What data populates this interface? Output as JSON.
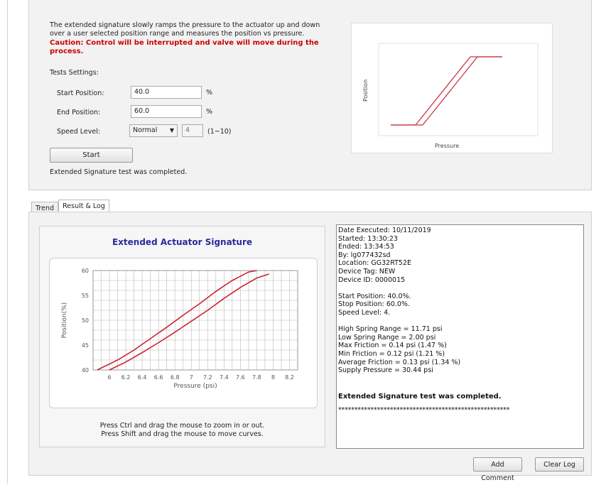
{
  "settings": {
    "description": "The extended signature slowly ramps the pressure to the actuator up and down over a user selected position range and measures the position vs pressure.",
    "caution": "Caution: Control will be interrupted and valve will move during the process.",
    "tests_settings_label": "Tests Settings:",
    "start_position_label": "Start Position:",
    "start_position_value": "40.0",
    "end_position_label": "End Position:",
    "end_position_value": "60.0",
    "unit": "%",
    "speed_level_label": "Speed Level:",
    "speed_select_value": "Normal",
    "speed_number_value": "4",
    "speed_range": "(1~10)",
    "start_button": "Start",
    "status": "Extended Signature test was completed."
  },
  "preview_chart": {
    "ylabel": "Position",
    "xlabel": "Pressure"
  },
  "tabs": [
    {
      "label": "Trend",
      "active": false
    },
    {
      "label": "Result & Log",
      "active": true
    }
  ],
  "chart_data": {
    "type": "line",
    "title": "Extended Actuator Signature",
    "xlabel": "Pressure (psi)",
    "ylabel": "Position(%)",
    "xlim": [
      5.8,
      8.3
    ],
    "ylim": [
      40,
      60
    ],
    "x_ticks": [
      "6",
      "6.2",
      "6.4",
      "6.6",
      "6.8",
      "7",
      "7.2",
      "7.4",
      "7.6",
      "7.8",
      "8",
      "8.2"
    ],
    "y_ticks": [
      "40",
      "45",
      "50",
      "55",
      "60"
    ],
    "grid": true,
    "color": "#cc2233",
    "series": [
      {
        "x": [
          5.85,
          6.1,
          6.3,
          6.5,
          6.7,
          6.9,
          7.1,
          7.3,
          7.5,
          7.7,
          7.8
        ],
        "y": [
          40,
          42,
          44,
          46.3,
          48.6,
          51,
          53.3,
          55.8,
          58,
          59.7,
          60
        ]
      },
      {
        "x": [
          6.0,
          6.2,
          6.4,
          6.6,
          6.8,
          7.0,
          7.2,
          7.4,
          7.6,
          7.8,
          7.95
        ],
        "y": [
          40,
          41.6,
          43.5,
          45.5,
          47.6,
          49.8,
          52,
          54.4,
          56.6,
          58.5,
          59.3
        ]
      }
    ]
  },
  "chart_hints": {
    "line1": "Press Ctrl and drag the mouse to zoom in or out.",
    "line2": "Press Shift and drag the mouse to move curves."
  },
  "log": {
    "lines": [
      "Date Executed: 10/11/2019",
      "Started: 13:30:23",
      "Ended: 13:34:53",
      "By: lg077432sd",
      "Location: GG32RT52E",
      "Device Tag: NEW",
      "Device ID: 0000015",
      "",
      "Start Position: 40.0%.",
      "Stop Position: 60.0%.",
      "Speed Level: 4.",
      "",
      "High Spring Range = 11.71 psi",
      "Low Spring Range = 2.00 psi",
      "Max Friction = 0.14 psi (1.47 %)",
      "Min Friction = 0.12 psi (1.21 %)",
      "Average Friction = 0.13 psi (1.34 %)",
      "Supply Pressure = 30.44 psi",
      "",
      ""
    ],
    "completed": "Extended Signature test was completed.",
    "separator": "*****************************************************",
    "add_comment_button": "Add Comment",
    "clear_log_button": "Clear Log"
  }
}
